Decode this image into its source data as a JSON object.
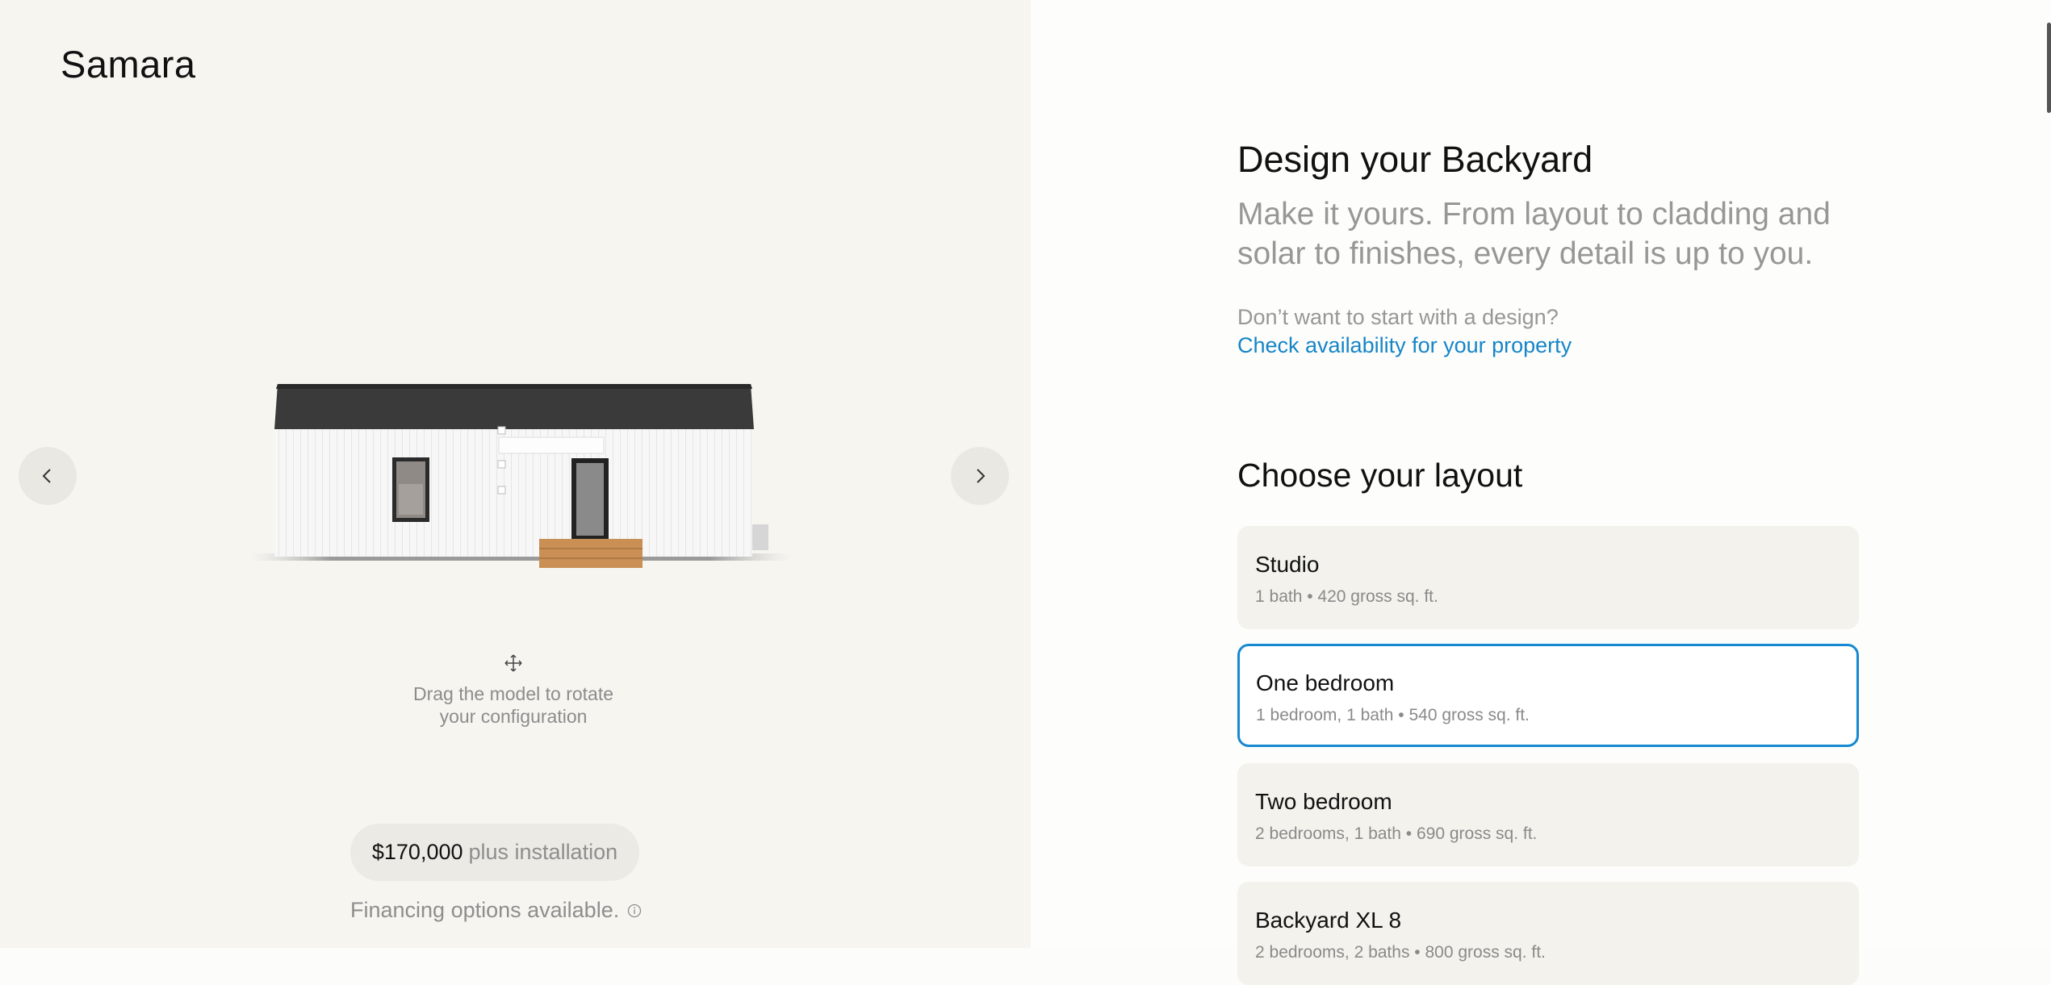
{
  "brand": {
    "logo_text": "Samara"
  },
  "viewer": {
    "prev_icon": "chevron-left-icon",
    "next_icon": "chevron-right-icon",
    "rotate_icon": "move-arrows-icon",
    "rotate_hint": "Drag the model to rotate\nyour configuration",
    "price": {
      "amount": "$170,000",
      "suffix": "plus installation"
    },
    "financing_text": "Financing options available.",
    "financing_icon": "info-icon"
  },
  "configurator": {
    "title": "Design your Backyard",
    "subtitle": "Make it yours. From layout to cladding and solar to finishes, every detail is up to you.",
    "question": "Don’t want to start with a design?",
    "availability_link": "Check availability for your property",
    "layout_title": "Choose your layout",
    "layouts": [
      {
        "name": "Studio",
        "details": "1 bath • 420 gross sq. ft.",
        "selected": false
      },
      {
        "name": "One bedroom",
        "details": "1 bedroom, 1 bath • 540 gross sq. ft.",
        "selected": true
      },
      {
        "name": "Two bedroom",
        "details": "2 bedrooms, 1 bath • 690 gross sq. ft.",
        "selected": false
      },
      {
        "name": "Backyard XL 8",
        "details": "2 bedrooms, 2 baths • 800 gross sq. ft.",
        "selected": false
      }
    ]
  },
  "colors": {
    "accent": "#1589d1",
    "link": "#1585c8",
    "panel_bg": "#f6f5f0"
  }
}
